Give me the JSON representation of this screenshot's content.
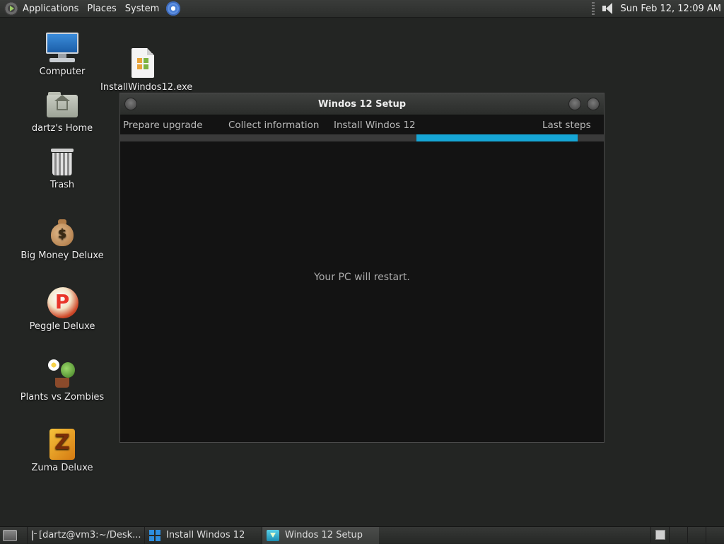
{
  "top_panel": {
    "menus": [
      "Applications",
      "Places",
      "System"
    ],
    "clock": "Sun Feb 12, 12:09 AM"
  },
  "desktop_icons": [
    {
      "label": "Computer",
      "icon": "computer-icon"
    },
    {
      "label": "dartz's Home",
      "icon": "home-folder-icon"
    },
    {
      "label": "Trash",
      "icon": "trash-icon"
    },
    {
      "label": "Big Money Deluxe",
      "icon": "money-bag-icon"
    },
    {
      "label": "Peggle Deluxe",
      "icon": "peggle-icon"
    },
    {
      "label": "Plants vs Zombies",
      "icon": "plants-vs-zombies-icon"
    },
    {
      "label": "Zuma Deluxe",
      "icon": "zuma-icon"
    },
    {
      "label": "InstallWindos12.exe",
      "icon": "exe-file-icon"
    }
  ],
  "setup_window": {
    "title": "Windos 12 Setup",
    "steps": [
      "Prepare upgrade",
      "Collect information",
      "Install Windos 12",
      "Last steps"
    ],
    "progress_fraction": 0.333,
    "message": "Your PC will restart."
  },
  "taskbar": {
    "tasks": [
      {
        "label": "[dartz@vm3:~/Desk...",
        "icon": "terminal-icon",
        "active": false
      },
      {
        "label": "Install Windos 12",
        "icon": "windows-logo-icon",
        "active": false
      },
      {
        "label": "Windos 12 Setup",
        "icon": "setup-icon",
        "active": true
      }
    ]
  },
  "colors": {
    "desktop_bg": "#232523",
    "window_bg": "#131313",
    "progress_accent": "#16a6d6"
  }
}
